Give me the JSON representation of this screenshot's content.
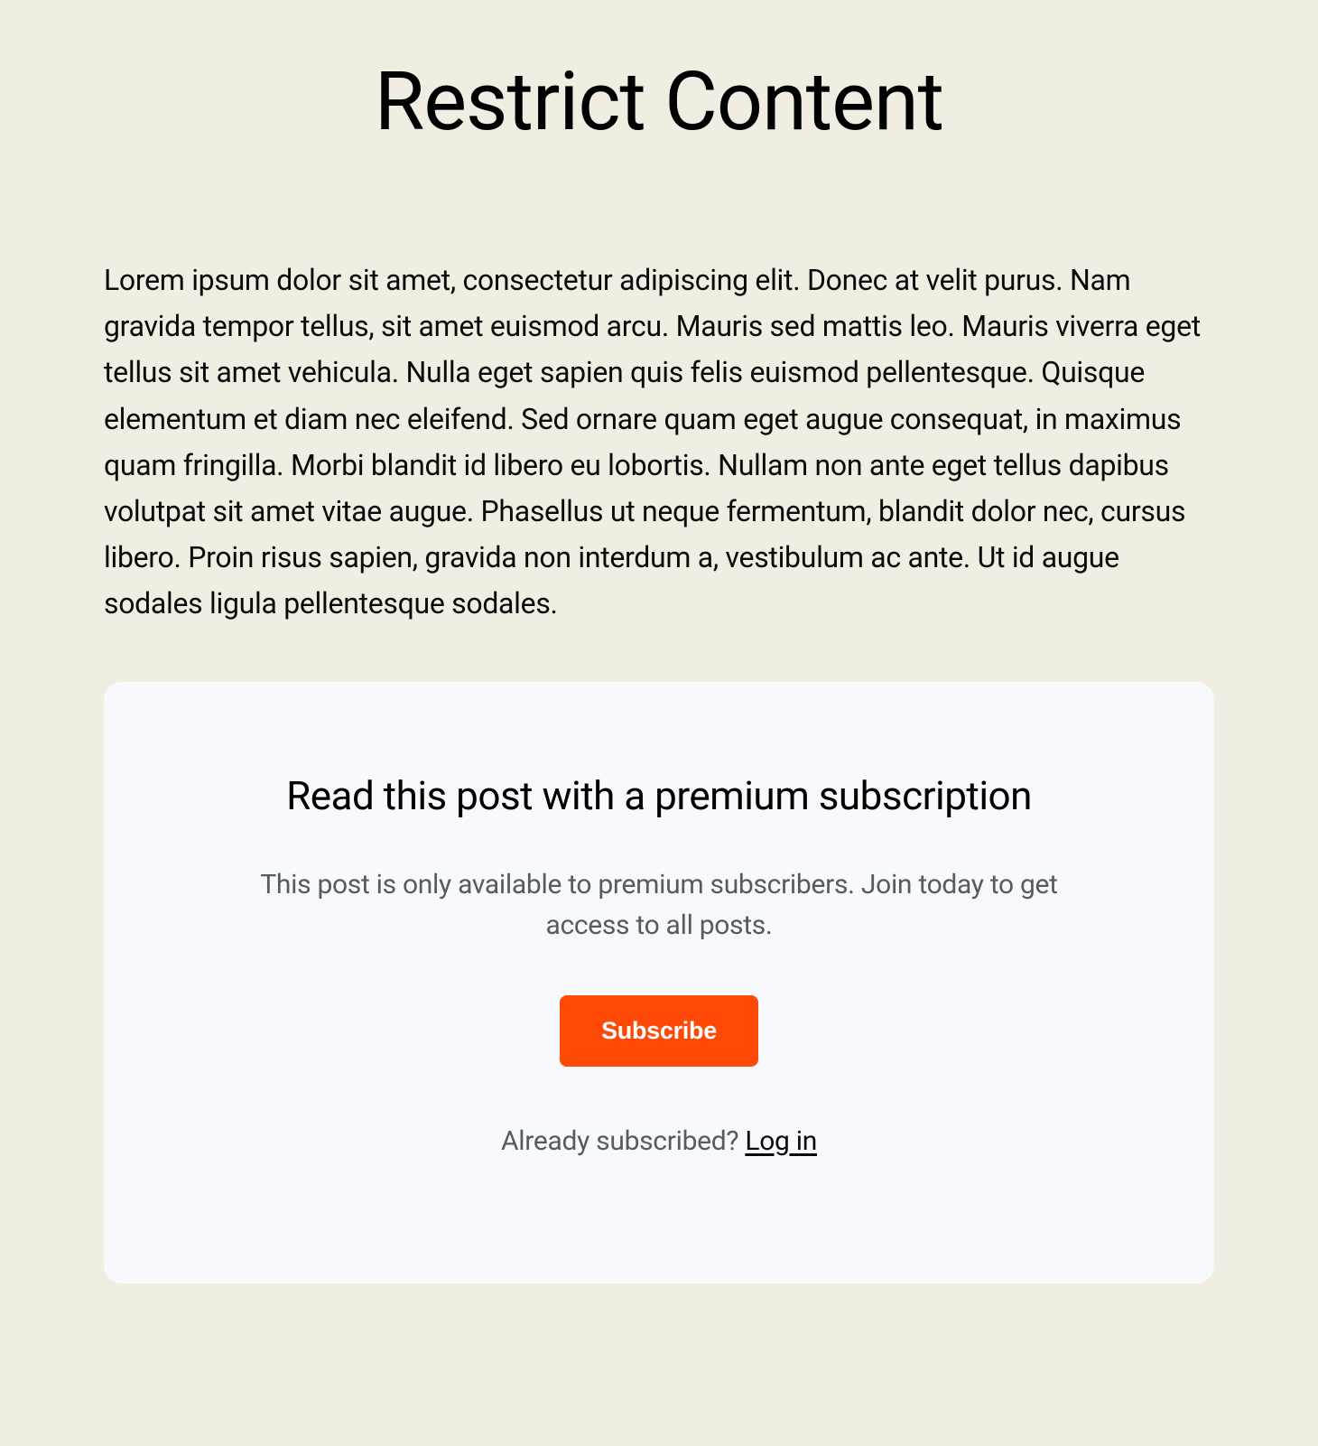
{
  "page": {
    "title": "Restrict Content",
    "preview_text": "Lorem ipsum dolor sit amet, consectetur adipiscing elit. Donec at velit purus. Nam gravida tempor tellus, sit amet euismod arcu. Mauris sed mattis leo. Mauris viverra eget tellus sit amet vehicula. Nulla eget sapien quis felis euismod pellentesque. Quisque elementum et diam nec eleifend. Sed ornare quam eget augue consequat, in maximus quam fringilla. Morbi blandit id libero eu lobortis. Nullam non ante eget tellus dapibus volutpat sit amet vitae augue. Phasellus ut neque fermentum, blandit dolor nec, cursus libero. Proin risus sapien, gravida non interdum a, vestibulum ac ante. Ut id augue sodales ligula pellentesque sodales."
  },
  "subscription_card": {
    "heading": "Read this post with a premium subscription",
    "subtext": "This post is only available to premium subscribers. Join today to get access to all posts.",
    "button_label": "Subscribe",
    "login_prompt_text": "Already subscribed? ",
    "login_link_label": "Log in"
  },
  "colors": {
    "background": "#f1ede2",
    "card_background": "#f7f9fc",
    "accent": "#ff4906",
    "text_primary": "#0a0a0a",
    "text_secondary": "#575a5f"
  }
}
